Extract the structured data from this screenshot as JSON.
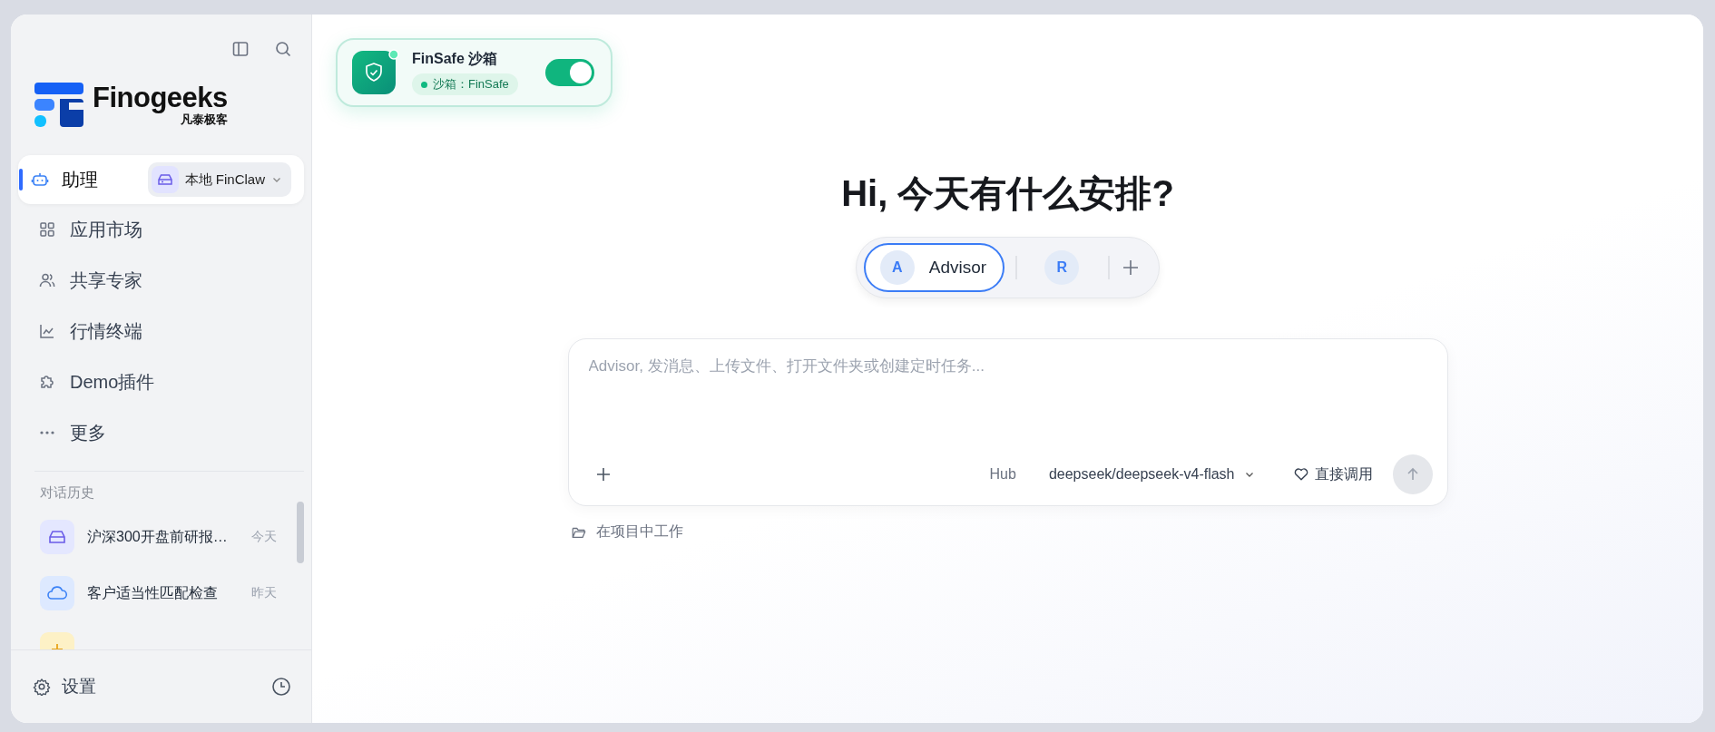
{
  "sidebar": {
    "logo": {
      "name": "Finogeeks",
      "subtitle": "凡泰极客"
    },
    "active_item": {
      "label": "助理",
      "selected": true,
      "runtime": "本地 FinClaw"
    },
    "items": [
      {
        "kind": "grid",
        "label": "应用市场",
        "selected": false
      },
      {
        "kind": "users",
        "label": "共享专家",
        "selected": false
      },
      {
        "kind": "chart",
        "label": "行情终端",
        "selected": false
      },
      {
        "kind": "puzzle",
        "label": "Demo插件",
        "selected": false
      },
      {
        "kind": "dots",
        "label": "更多",
        "selected": false
      }
    ],
    "history_title": "对话历史",
    "history": [
      {
        "kind": "drive",
        "title": "沪深300开盘前研报…",
        "time": "今天",
        "color": "#e4e7ff"
      },
      {
        "kind": "cloud",
        "title": "客户适当性匹配检查",
        "time": "昨天",
        "color": "#dde9ff"
      },
      {
        "kind": "plus",
        "color": "#fdf1c6"
      }
    ],
    "footer": {
      "label": "设置"
    }
  },
  "sandbox": {
    "title": "FinSafe 沙箱",
    "status": "沙箱：FinSafe",
    "on": true
  },
  "greeting": "Hi, 今天有什么安排?",
  "agents": [
    {
      "initial": "A",
      "label": "Advisor",
      "selected": true
    },
    {
      "initial": "R",
      "selected": false
    }
  ],
  "composer": {
    "placeholder": "Advisor, 发消息、上传文件、打开文件夹或创建定时任务...",
    "provider": "Hub",
    "model": "deepseek/deepseek-v4-flash",
    "mode": "直接调用"
  },
  "project_link": "在项目中工作"
}
